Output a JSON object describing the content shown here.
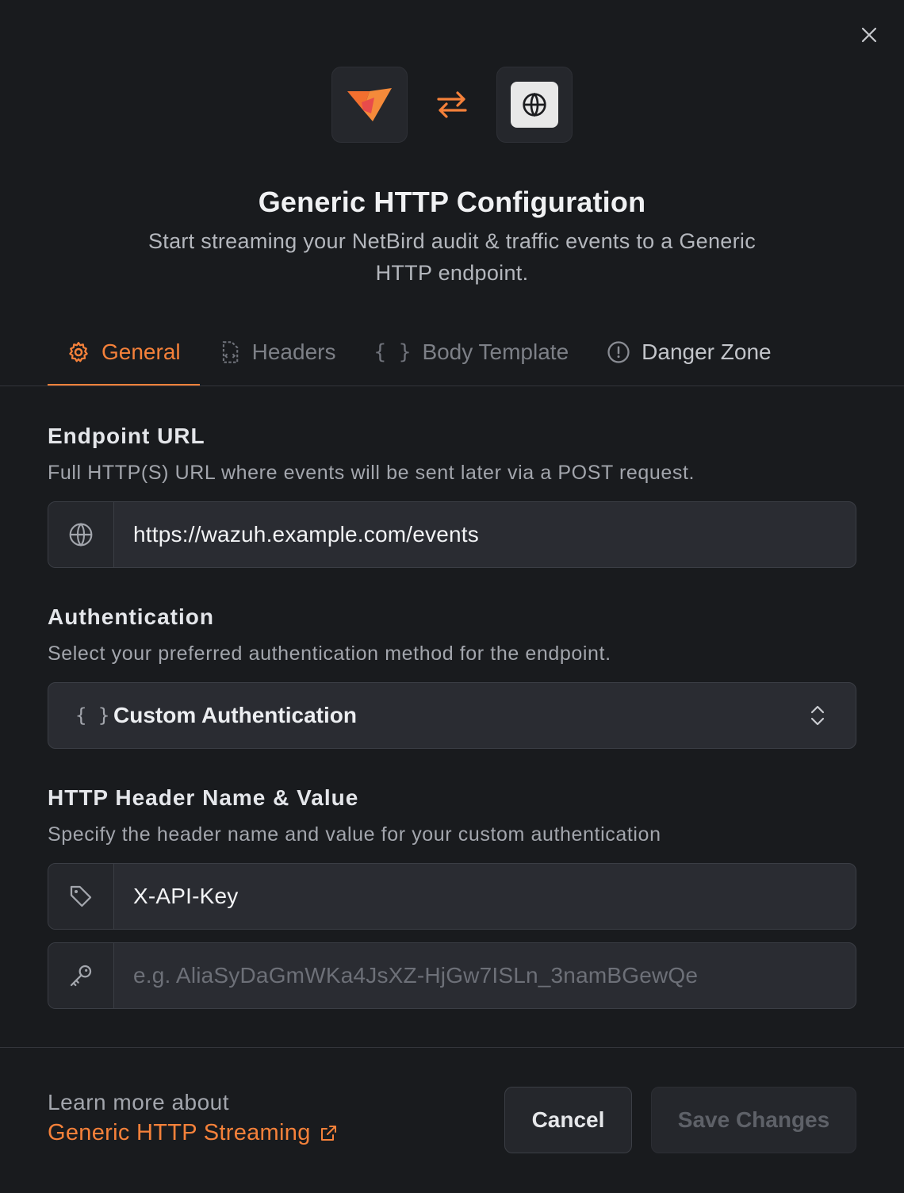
{
  "dialog": {
    "title": "Generic HTTP Configuration",
    "subtitle": "Start streaming your NetBird audit & traffic events to a Generic HTTP endpoint.",
    "icons": {
      "close": "close-icon",
      "source_logo": "netbird-logo",
      "swap": "swap-arrows-icon",
      "target_logo": "globe-icon"
    },
    "accent_color": "#f5813a"
  },
  "tabs": [
    {
      "label": "General",
      "icon": "gear-icon",
      "active": true
    },
    {
      "label": "Headers",
      "icon": "file-code-icon",
      "active": false
    },
    {
      "label": "Body Template",
      "icon": "braces-icon",
      "active": false
    },
    {
      "label": "Danger Zone",
      "icon": "alert-circle-icon",
      "active": false
    }
  ],
  "endpoint": {
    "label": "Endpoint URL",
    "help": "Full HTTP(S) URL where events will be sent later via a POST request.",
    "value": "https://wazuh.example.com/events",
    "icon": "globe-icon"
  },
  "auth": {
    "label": "Authentication",
    "help": "Select your preferred authentication method for the endpoint.",
    "selected": "Custom Authentication",
    "braces": "{ }",
    "icon": "chevron-up-down-icon"
  },
  "header": {
    "label": "HTTP Header Name & Value",
    "help": "Specify the header name and value for your custom authentication",
    "name_value": "X-API-Key",
    "name_icon": "tag-icon",
    "value_placeholder": "e.g. AliaSyDaGmWKa4JsXZ-HjGw7ISLn_3namBGewQe",
    "value_icon": "key-icon"
  },
  "footer": {
    "learn_prefix": "Learn more about",
    "learn_link": "Generic HTTP Streaming",
    "learn_icon": "external-link-icon",
    "cancel": "Cancel",
    "save": "Save Changes"
  }
}
